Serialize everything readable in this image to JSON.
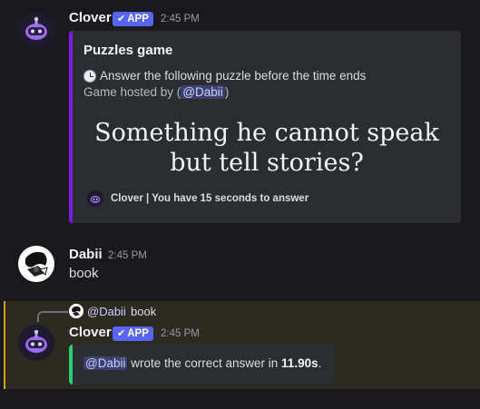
{
  "messages": {
    "first": {
      "author": "Clover",
      "badge": "APP",
      "time": "2:45 PM",
      "embed": {
        "title": "Puzzles game",
        "instruction": "Answer the following puzzle before the time ends",
        "hosted_prefix": "Game hosted by (",
        "hosted_mention": "@Dabii",
        "hosted_suffix": ")",
        "puzzle_line1": "Something he cannot speak",
        "puzzle_line2": "but tell stories?",
        "footer": "Clover | You have 15 seconds to answer"
      }
    },
    "second": {
      "author": "Dabii",
      "time": "2:45 PM",
      "text": "book"
    },
    "third": {
      "reply_mention": "@Dabii",
      "reply_text": "book",
      "author": "Clover",
      "badge": "APP",
      "time": "2:45 PM",
      "embed": {
        "mention": "@Dabii",
        "text_before": " wrote the correct answer in ",
        "time_value": "11.90s",
        "text_after": "."
      }
    }
  },
  "colors": {
    "embed_puzzle_border": "#7c1ae6",
    "embed_answer_border": "#2ecc71",
    "badge": "#5865f2",
    "highlight": "#d4a020"
  },
  "icons": {
    "clover_avatar": "robot-avatar-icon",
    "dabii_avatar": "anime-avatar-icon",
    "instruction": "clock-icon",
    "badge_check": "checkmark-icon"
  }
}
